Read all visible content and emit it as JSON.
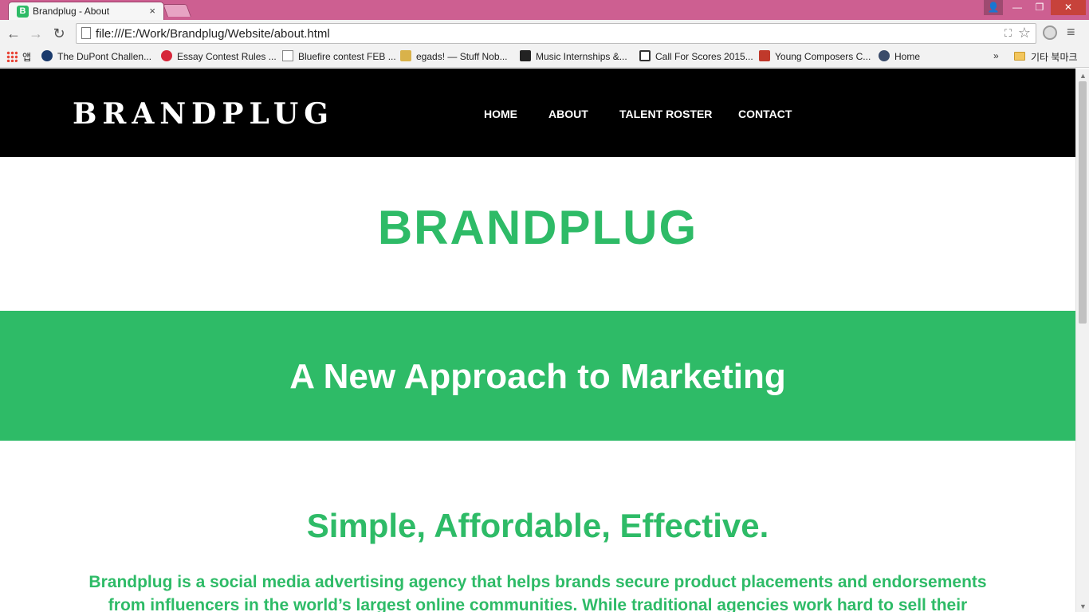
{
  "browser": {
    "tab_title": "Brandplug - About",
    "tab_favicon_letter": "B",
    "tab_close": "×",
    "url": "file:///E:/Work/Brandplug/Website/about.html",
    "icons": {
      "back": "←",
      "forward": "→",
      "reload": "↻",
      "star": "☆",
      "menu": "≡",
      "translate": "⛶",
      "user": "👤",
      "minimize": "—",
      "maximize": "❐",
      "close": "✕"
    },
    "bookmarks": [
      {
        "label": "앱",
        "color": "#4285f4"
      },
      {
        "label": "The DuPont Challen...",
        "color": "#1a3a6c"
      },
      {
        "label": "Essay Contest Rules ...",
        "color": "#d6273a"
      },
      {
        "label": "Bluefire contest FEB ...",
        "color": "#ffffff"
      },
      {
        "label": "egads! — Stuff Nob...",
        "color": "#d9b24a"
      },
      {
        "label": "Music Internships &...",
        "color": "#222222"
      },
      {
        "label": "Call For Scores 2015...",
        "color": "#333333"
      },
      {
        "label": "Young Composers C...",
        "color": "#c0392b"
      },
      {
        "label": "Home",
        "color": "#3a4b6a"
      }
    ],
    "bookmarks_more": "»",
    "other_bookmarks": "기타 북마크"
  },
  "site": {
    "logo": "BRANDPLUG",
    "nav": [
      "HOME",
      "ABOUT",
      "TALENT ROSTER",
      "CONTACT"
    ],
    "hero_title": "BRANDPLUG",
    "band_title": "A New Approach to Marketing",
    "subhead": "Simple, Affordable, Effective.",
    "body": "Brandplug is a social media advertising agency that helps brands secure product placements and endorsements from influencers in the world’s largest online communities. While traditional agencies work hard to sell their creative expertise,"
  },
  "colors": {
    "brand_green": "#2ebb67",
    "header_black": "#000000",
    "titlebar": "#cd5f91"
  }
}
